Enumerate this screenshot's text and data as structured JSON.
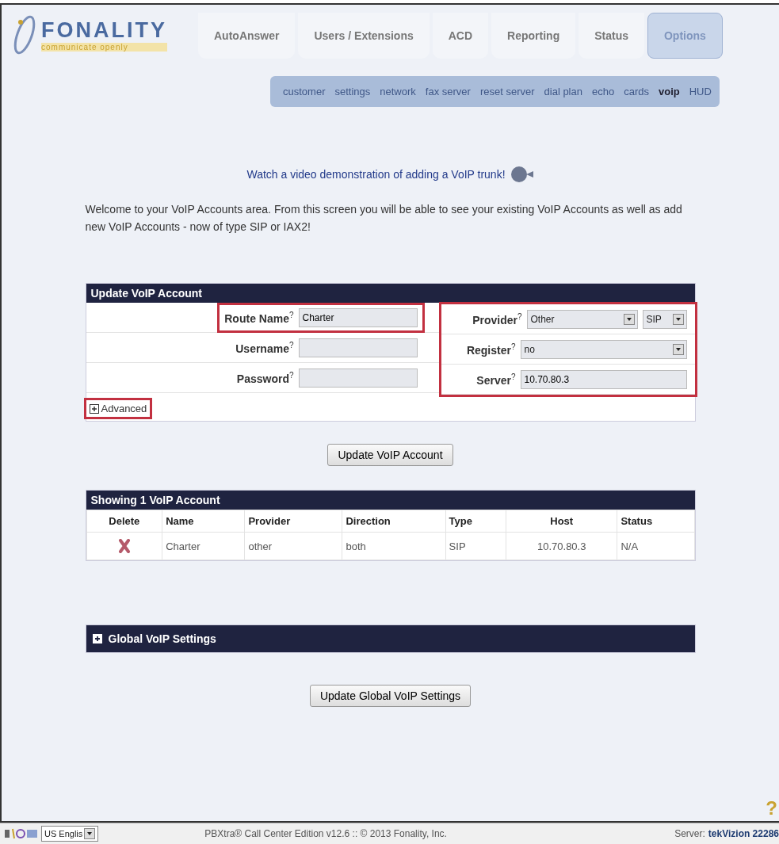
{
  "logo": {
    "name": "FONALITY",
    "tagline": "communicate openly"
  },
  "tabs": [
    {
      "label": "AutoAnswer",
      "selected": false
    },
    {
      "label": "Users / Extensions",
      "selected": false
    },
    {
      "label": "ACD",
      "selected": false
    },
    {
      "label": "Reporting",
      "selected": false
    },
    {
      "label": "Status",
      "selected": false
    },
    {
      "label": "Options",
      "selected": true
    }
  ],
  "subnav": [
    {
      "label": "customer",
      "selected": false
    },
    {
      "label": "settings",
      "selected": false
    },
    {
      "label": "network",
      "selected": false
    },
    {
      "label": "fax server",
      "selected": false
    },
    {
      "label": "reset server",
      "selected": false
    },
    {
      "label": "dial plan",
      "selected": false
    },
    {
      "label": "echo",
      "selected": false
    },
    {
      "label": "cards",
      "selected": false
    },
    {
      "label": "voip",
      "selected": true
    },
    {
      "label": "HUD",
      "selected": false
    }
  ],
  "video_link": "Watch a video demonstration of adding a VoIP trunk!",
  "intro": "Welcome to your VoIP Accounts area. From this screen you will be able to see your existing VoIP Accounts as well as add new VoIP Accounts - now of type SIP or IAX2!",
  "update_form": {
    "title": "Update VoIP Account",
    "left_fields": [
      {
        "label": "Route Name",
        "help": "?",
        "value": "Charter",
        "highlighted": true
      },
      {
        "label": "Username",
        "help": "?",
        "highlighted": false
      },
      {
        "label": "Password",
        "help": "?",
        "highlighted": false
      }
    ],
    "right_highlighted": true,
    "right_fields": [
      {
        "label": "Provider",
        "help": "?",
        "controls": [
          {
            "kind": "select",
            "value": "Other"
          },
          {
            "kind": "select",
            "value": "SIP"
          }
        ]
      },
      {
        "label": "Register",
        "help": "?",
        "controls": [
          {
            "kind": "select",
            "value": "no"
          }
        ]
      },
      {
        "label": "Server",
        "help": "?",
        "controls": [
          {
            "kind": "text",
            "value": "10.70.80.3"
          }
        ]
      }
    ],
    "advanced": {
      "label": "Advanced",
      "expanded": false,
      "highlighted": true
    },
    "button": "Update VoIP Account"
  },
  "accounts": {
    "title": "Showing 1 VoIP Account",
    "columns": [
      "Delete",
      "Name",
      "Provider",
      "Direction",
      "Type",
      "Host",
      "Status"
    ],
    "rows": [
      {
        "name": "Charter",
        "provider": "other",
        "direction": "both",
        "type": "SIP",
        "host": "10.70.80.3",
        "status": "N/A"
      }
    ]
  },
  "global_settings": {
    "title": "Global VoIP Settings",
    "expanded": false,
    "button": "Update Global VoIP Settings"
  },
  "help_mark": "?",
  "status_bar": {
    "language": "US Englis",
    "center": "PBXtra® Call Center Edition v12.6 :: © 2013 Fonality, Inc.",
    "server_label": "Server:",
    "server": "tekVizion 22286"
  }
}
